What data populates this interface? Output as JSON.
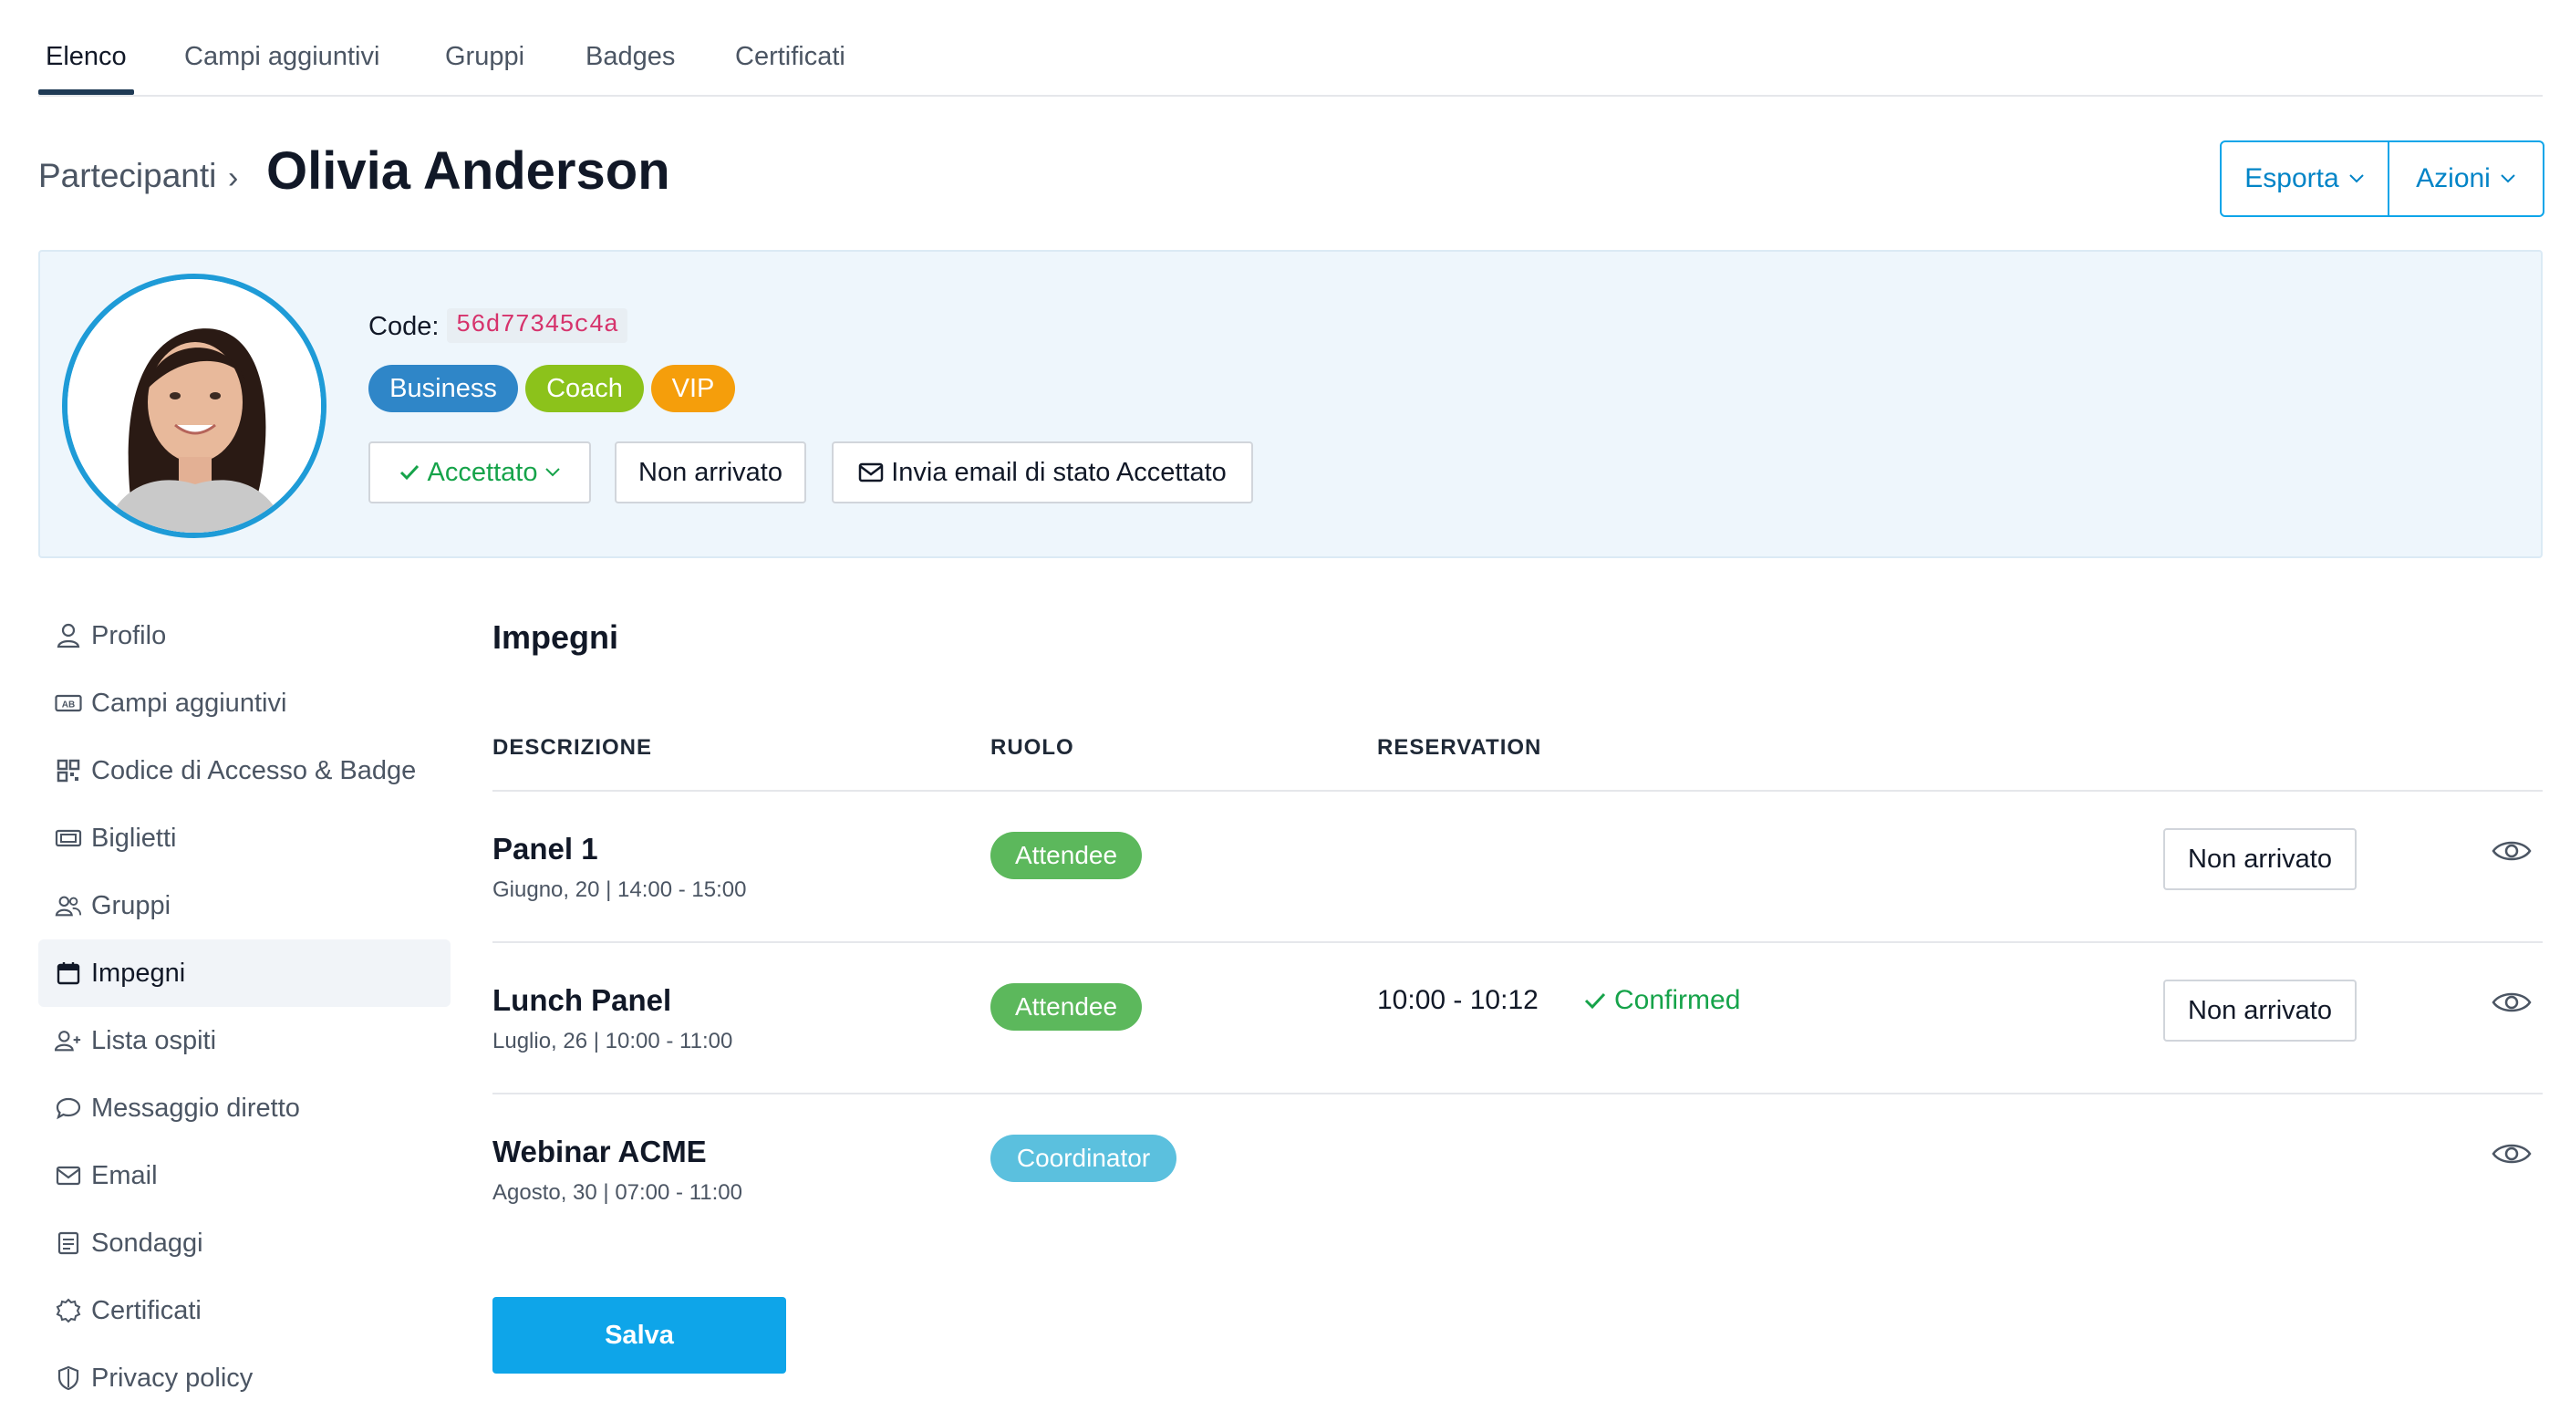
{
  "tabs": [
    "Elenco",
    "Campi aggiuntivi",
    "Gruppi",
    "Badges",
    "Certificati"
  ],
  "breadcrumb": "Partecipanti",
  "breadcrumb_sep": "›",
  "title": "Olivia Anderson",
  "header_buttons": {
    "export": "Esporta",
    "actions": "Azioni"
  },
  "profile": {
    "code_label": "Code:",
    "code": "56d77345c4a",
    "tags": [
      "Business",
      "Coach",
      "VIP"
    ],
    "status_button": "Accettato",
    "not_arrived_button": "Non arrivato",
    "send_email_button": "Invia email di stato Accettato"
  },
  "sidebar": [
    {
      "label": "Profilo",
      "icon": "user-icon"
    },
    {
      "label": "Campi aggiuntivi",
      "icon": "ab-field-icon"
    },
    {
      "label": "Codice di Accesso & Badge",
      "icon": "qr-code-icon"
    },
    {
      "label": "Biglietti",
      "icon": "ticket-icon"
    },
    {
      "label": "Gruppi",
      "icon": "users-icon"
    },
    {
      "label": "Impegni",
      "icon": "calendar-icon",
      "active": true
    },
    {
      "label": "Lista ospiti",
      "icon": "user-plus-icon"
    },
    {
      "label": "Messaggio diretto",
      "icon": "chat-icon"
    },
    {
      "label": "Email",
      "icon": "mail-icon"
    },
    {
      "label": "Sondaggi",
      "icon": "survey-icon"
    },
    {
      "label": "Certificati",
      "icon": "certificate-icon"
    },
    {
      "label": "Privacy policy",
      "icon": "shield-icon"
    }
  ],
  "main": {
    "section_title": "Impegni",
    "headers": {
      "description": "DESCRIZIONE",
      "role": "RUOLO",
      "reservation": "RESERVATION"
    },
    "rows": [
      {
        "title": "Panel 1",
        "subtitle": "Giugno, 20 | 14:00 - 15:00",
        "role": "Attendee",
        "time": "",
        "status": "",
        "button": "Non arrivato"
      },
      {
        "title": "Lunch Panel",
        "subtitle": "Luglio, 26 | 10:00 - 11:00",
        "role": "Attendee",
        "time": "10:00 - 10:12",
        "status": "Confirmed",
        "button": "Non arrivato"
      },
      {
        "title": "Webinar ACME",
        "subtitle": "Agosto, 30 | 07:00 - 11:00",
        "role": "Coordinator",
        "time": "",
        "status": "",
        "button": ""
      }
    ],
    "save_button": "Salva"
  }
}
